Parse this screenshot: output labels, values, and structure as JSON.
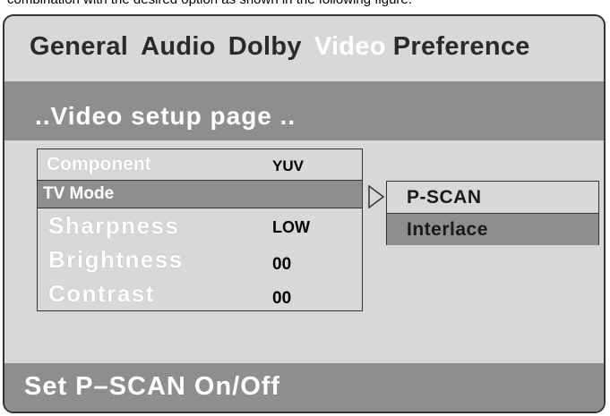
{
  "caption": "combination with the desired option as shown in the following figure.",
  "tabs": [
    {
      "label": "General",
      "active": false
    },
    {
      "label": "Audio",
      "active": false
    },
    {
      "label": "Dolby",
      "active": false
    },
    {
      "label": "Video",
      "active": true
    },
    {
      "label": "Preference",
      "active": false
    }
  ],
  "page_title": "..Video setup page ..",
  "menu": {
    "items": [
      {
        "label": "Component",
        "value": "YUV"
      },
      {
        "label": "TV Mode",
        "value": ""
      },
      {
        "label": "Sharpness",
        "value": "LOW"
      },
      {
        "label": "Brightness",
        "value": "00"
      },
      {
        "label": "Contrast",
        "value": "00"
      }
    ],
    "selected": "TV Mode"
  },
  "submenu": {
    "options": [
      "P-SCAN",
      "Interlace"
    ],
    "highlighted": "Interlace"
  },
  "status_text": "Set P–SCAN On/Off",
  "colors": {
    "panel_bg": "#d8d8d8",
    "highlight_bg": "#8e8e8e",
    "active_tab_text": "#ffffff",
    "inactive_tab_text": "#2a2a2a"
  },
  "icons": {
    "submenu_arrow": "hollow-right-triangle-icon"
  }
}
